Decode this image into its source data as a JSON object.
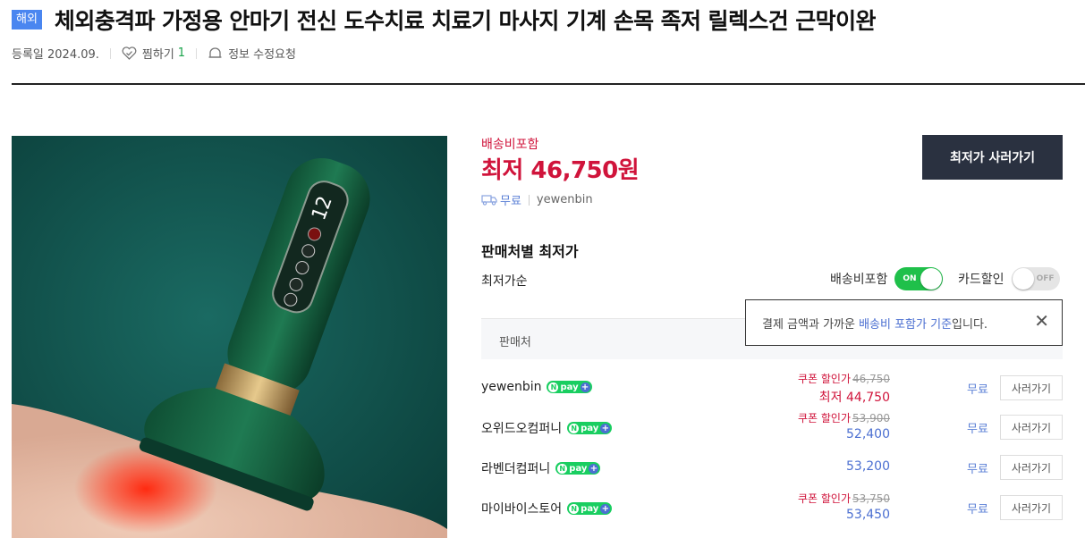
{
  "header": {
    "badge": "해외",
    "title": "체외충격파 가정용 안마기 전신 도수치료 치료기 마사지 기계 손목 족저 릴렉스건 근막이완"
  },
  "meta": {
    "registered": "등록일 2024.09.",
    "zzim_label": "찜하기",
    "zzim_count": "1",
    "report_label": "정보 수정요청"
  },
  "product_image": {
    "device_display": "12",
    "device_buttons": [
      "",
      "",
      "",
      "",
      ""
    ]
  },
  "summary": {
    "shipping_included": "배송비포함",
    "lowest_price": "최저 46,750원",
    "shipping_fee": "무료",
    "seller": "yewenbin",
    "buy_button": "최저가 사러가기"
  },
  "sellers_section": {
    "title": "판매처별 최저가",
    "sort_label": "최저가순",
    "toggle_shipping": {
      "label": "배송비포함",
      "state": "ON"
    },
    "toggle_card": {
      "label": "카드할인",
      "state": "OFF"
    },
    "column_header": "판매처",
    "tooltip": {
      "prefix": "결제 금액과 가까운 ",
      "highlight": "배송비 포함가 기준",
      "suffix": "입니다."
    },
    "npay_label": "pay",
    "coupon_label": "쿠폰 할인가",
    "rows": [
      {
        "seller": "yewenbin",
        "coupon_orig": "46,750",
        "price": "최저 44,750",
        "shipping": "무료",
        "buy": "사러가기"
      },
      {
        "seller": "오위드오컴퍼니",
        "coupon_orig": "53,900",
        "price": "52,400",
        "shipping": "무료",
        "buy": "사러가기"
      },
      {
        "seller": "라벤더컴퍼니",
        "coupon_orig": "",
        "price": "53,200",
        "shipping": "무료",
        "buy": "사러가기"
      },
      {
        "seller": "마이바이스토어",
        "coupon_orig": "53,750",
        "price": "53,450",
        "shipping": "무료",
        "buy": "사러가기"
      }
    ]
  },
  "colors": {
    "accent_red": "#d0143b",
    "accent_blue": "#4b6fd1",
    "npay_green": "#19ce60",
    "toggle_on": "#1fc04a",
    "dark_button": "#2a3140"
  }
}
